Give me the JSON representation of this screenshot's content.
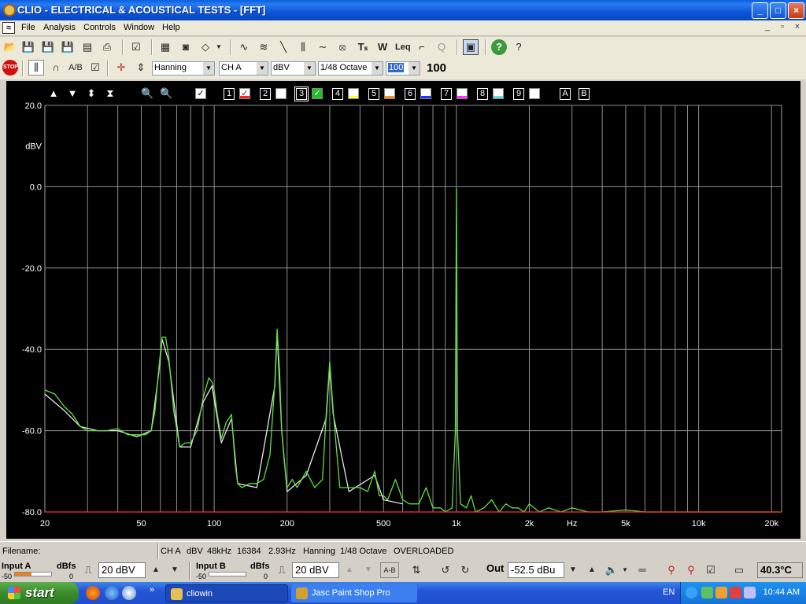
{
  "window": {
    "title": "CLIO - ELECTRICAL & ACOUSTICAL TESTS - [FFT]",
    "min": "_",
    "max": "□",
    "close": "×"
  },
  "menu": {
    "items": [
      "File",
      "Analysis",
      "Controls",
      "Window",
      "Help"
    ],
    "mdi": [
      "_",
      "▫",
      "×"
    ]
  },
  "toolbar2": {
    "window_fn": "Hanning",
    "channel": "CH A",
    "unit": "dBV",
    "smoothing": "1/48 Octave",
    "averages_input": "100",
    "averages_display": "100"
  },
  "graph_controls": {
    "slots": [
      "1",
      "2",
      "3",
      "4",
      "5",
      "6",
      "7",
      "8",
      "9"
    ],
    "slot_colors": [
      "#ff2020",
      "#ffffff",
      "#20c020",
      "#ffff40",
      "#ff9020",
      "#2030ff",
      "#ff30ff",
      "#60e0e0",
      "#ffffff"
    ],
    "ab": [
      "A",
      "B"
    ]
  },
  "chart_data": {
    "type": "line",
    "xlabel": "Hz",
    "ylabel": "dBV",
    "x_scale": "log",
    "xlim": [
      20,
      22000
    ],
    "ylim": [
      -80,
      20
    ],
    "x_ticks": [
      "20",
      "50",
      "100",
      "200",
      "500",
      "1k",
      "2k",
      "5k",
      "10k",
      "20k"
    ],
    "y_ticks": [
      "20.0",
      "0.0",
      "-20.0",
      "-40.0",
      "-60.0",
      "-80.0"
    ],
    "grid": true,
    "background": "#000000",
    "series": [
      {
        "color": "#60e040",
        "x": [
          20,
          22,
          24,
          26,
          28,
          30,
          33,
          36,
          40,
          44,
          48,
          52,
          55,
          57,
          59,
          61,
          63,
          65,
          68,
          72,
          76,
          80,
          85,
          90,
          95,
          98,
          100,
          103,
          107,
          112,
          118,
          122,
          125,
          130,
          140,
          150,
          160,
          170,
          178,
          182,
          186,
          190,
          195,
          200,
          210,
          220,
          240,
          260,
          280,
          290,
          300,
          310,
          330,
          360,
          400,
          430,
          460,
          480,
          500,
          520,
          560,
          600,
          640,
          700,
          750,
          800,
          860,
          900,
          960,
          990,
          1000,
          1010,
          1040,
          1100,
          1150,
          1200,
          1300,
          1400,
          1500,
          1600,
          1700,
          1800,
          1900,
          2000,
          2200,
          2400,
          2700,
          3000,
          3500,
          4000,
          5000,
          6000,
          8000,
          10000,
          15000,
          20000,
          22000
        ],
        "y": [
          -50,
          -51,
          -54,
          -56,
          -59,
          -60,
          -60,
          -60,
          -59.5,
          -61,
          -61,
          -61,
          -60,
          -55,
          -45,
          -37,
          -37,
          -42,
          -55,
          -64,
          -63,
          -63,
          -60,
          -52,
          -47,
          -48,
          -50,
          -56,
          -62,
          -58,
          -56,
          -68,
          -73,
          -74,
          -73,
          -73,
          -72,
          -66,
          -48,
          -35,
          -45,
          -60,
          -68,
          -74,
          -72,
          -74,
          -70,
          -74,
          -72,
          -56,
          -43,
          -55,
          -74,
          -74,
          -74,
          -75,
          -70,
          -76,
          -76,
          -77,
          -72,
          -77,
          -78,
          -78,
          -74,
          -79,
          -79,
          -80,
          -79,
          -60,
          -0.5,
          -60,
          -78,
          -79,
          -76,
          -80,
          -79,
          -77,
          -80,
          -78,
          -79,
          -79,
          -80,
          -78,
          -80,
          -79,
          -80,
          -79,
          -80,
          -80,
          -79.5,
          -80,
          -80,
          -80,
          -80,
          -80,
          -80
        ]
      },
      {
        "color": "#e8e8e8",
        "x": [
          20,
          24,
          28,
          33,
          40,
          48,
          55,
          59,
          61,
          65,
          72,
          80,
          90,
          98,
          107,
          118,
          125,
          150,
          178,
          182,
          190,
          200,
          240,
          290,
          300,
          310,
          360,
          460,
          500,
          600
        ],
        "y": [
          -51,
          -55,
          -59,
          -60,
          -60,
          -61.5,
          -60,
          -46,
          -37.5,
          -43,
          -64,
          -64,
          -53,
          -49,
          -63,
          -57,
          -73,
          -74,
          -49,
          -36,
          -60,
          -75,
          -71,
          -57,
          -44,
          -56,
          -75,
          -71,
          -77,
          -78
        ]
      },
      {
        "color": "#ff3030",
        "x": [
          20,
          22000
        ],
        "y": [
          -80,
          -80
        ]
      }
    ]
  },
  "status": {
    "filename_label": "Filename:",
    "info": [
      "CH A",
      "dBV",
      "48kHz",
      "16384",
      "2.93Hz",
      "Hanning",
      "1/48 Octave",
      "OVERLOADED"
    ]
  },
  "inputs": {
    "a_label": "Input A",
    "b_label": "Input B",
    "dbfs": "dBfs",
    "min": "-50",
    "zero": "0",
    "a_range": "20 dBV",
    "b_range": "20 dBV",
    "a_level_pct": 45,
    "b_level_pct": 0,
    "ab_label": "A-B",
    "out_label": "Out",
    "out_value": "-52.5 dBu",
    "temperature": "40.3°C"
  },
  "taskbar": {
    "start": "start",
    "tasks": [
      "cliowin",
      "Jasc Paint Shop Pro"
    ],
    "lang": "EN",
    "clock": "10:44 AM"
  }
}
